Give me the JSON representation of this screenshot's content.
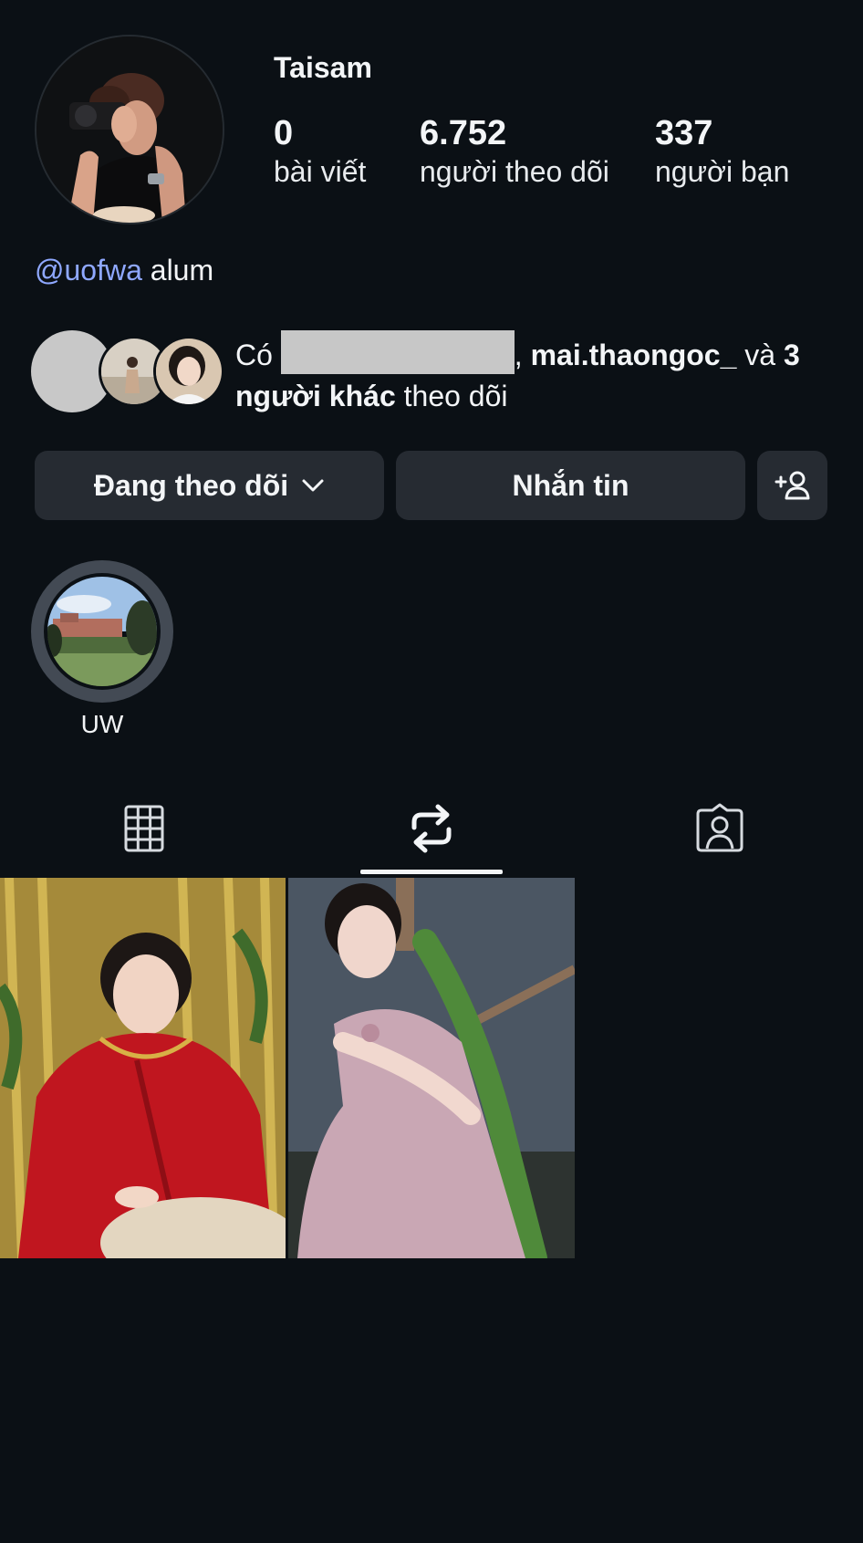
{
  "profile": {
    "username": "Taisam",
    "bio_mention": "@uofwa",
    "bio_text": " alum"
  },
  "stats": [
    {
      "value": "0",
      "label": "bài viết"
    },
    {
      "value": "6.752",
      "label": "người theo dõi"
    },
    {
      "value": "337",
      "label": "người bạn"
    }
  ],
  "mutual": {
    "prefix": "Có ",
    "comma": ", ",
    "name": "mai.thaongoc_",
    "and": " và ",
    "others": "3 người khác",
    "suffix": " theo dõi"
  },
  "actions": {
    "following_label": "Đang theo dõi",
    "message_label": "Nhắn tin"
  },
  "highlights": [
    {
      "label": "UW"
    }
  ],
  "tabs": {
    "active": "reposts",
    "items": [
      {
        "name": "posts",
        "icon": "grid-icon"
      },
      {
        "name": "reposts",
        "icon": "repost-icon"
      },
      {
        "name": "tagged",
        "icon": "tagged-person-icon"
      }
    ]
  },
  "colors": {
    "background": "#0b1015",
    "button": "#262b32",
    "mention": "#8fa8ff"
  }
}
